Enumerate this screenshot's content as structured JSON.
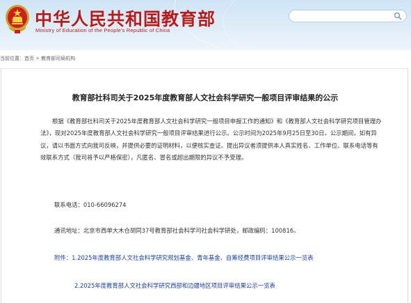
{
  "header": {
    "site_title": "中华人民共和国教育部",
    "site_subtitle": "Ministry of Education of the People's Republic of China",
    "search": {
      "placeholder": ""
    },
    "colors": {
      "title": "#b21e1e",
      "banner": "#d6e8f7"
    }
  },
  "breadcrumb": {
    "prefix": "当前位置：",
    "home": "首页",
    "separator": ">",
    "current": "教育部司局机构"
  },
  "article": {
    "title": "教育部社科司关于2025年度教育部人文社会科学研究一般项目评审结果的公示",
    "body": "根据《教育部社科司关于2025年度教育部人文社会科学研究一般项目申报工作的通知》和《教育部人文社会科学研究项目管理办法》，现对2025年度教育部人文社会科学研究一般项目评审结果进行公示。公示时间为2025年9月25日至30日。公示期间，如有异议，请以书面方式向我司反映，并提供必要的证明材料，以便核实查证。提出异议者须提供本人真实姓名、工作单位、联系电话等有效联系方式（我司将予以严格保密），凡匿名、冒名或超出期限的异议不予受理。",
    "contact": "联系电话：010-66096274",
    "address": "通讯地址：北京市西单大木仓胡同37号教育部社会科学司社会科学研处，邮政编码：100816。",
    "attachments_label": "附件：",
    "attachments": [
      "1.2025年度教育部人文社会科学研究规划基金、青年基金、自筹经费项目评审结果公示一览表",
      "2.2025年度教育部人文社会科学研究西部和边疆地区项目评审结果公示一览表"
    ],
    "link_color": "#1a3f99"
  }
}
